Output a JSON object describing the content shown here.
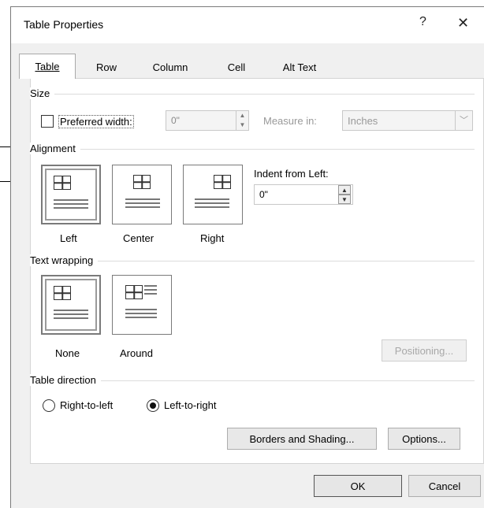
{
  "dialog": {
    "title": "Table Properties",
    "help_glyph": "?",
    "close_glyph": "✕"
  },
  "tabs": [
    {
      "label": "Table",
      "active": true
    },
    {
      "label": "Row",
      "active": false
    },
    {
      "label": "Column",
      "active": false
    },
    {
      "label": "Cell",
      "active": false
    },
    {
      "label": "Alt Text",
      "active": false
    }
  ],
  "size": {
    "group_label": "Size",
    "preferred_width_label": "Preferred width:",
    "preferred_width_checked": false,
    "preferred_width_value": "0\"",
    "measure_in_label": "Measure in:",
    "measure_in_value": "Inches"
  },
  "alignment": {
    "group_label": "Alignment",
    "options": [
      {
        "label": "Left",
        "selected": true
      },
      {
        "label": "Center",
        "selected": false
      },
      {
        "label": "Right",
        "selected": false
      }
    ],
    "indent_label": "Indent from Left:",
    "indent_value": "0\""
  },
  "text_wrapping": {
    "group_label": "Text wrapping",
    "options": [
      {
        "label": "None",
        "selected": true
      },
      {
        "label": "Around",
        "selected": false
      }
    ],
    "positioning_label": "Positioning..."
  },
  "table_direction": {
    "group_label": "Table direction",
    "options": [
      {
        "label": "Right-to-left",
        "checked": false
      },
      {
        "label": "Left-to-right",
        "checked": true
      }
    ]
  },
  "buttons": {
    "borders_shading": "Borders and Shading...",
    "options": "Options...",
    "ok": "OK",
    "cancel": "Cancel"
  },
  "icons": [
    "help-icon",
    "close-icon",
    "spin-up-icon",
    "spin-down-icon",
    "dropdown-arrow-icon",
    "align-left-icon",
    "align-center-icon",
    "align-right-icon",
    "wrap-none-icon",
    "wrap-around-icon"
  ]
}
